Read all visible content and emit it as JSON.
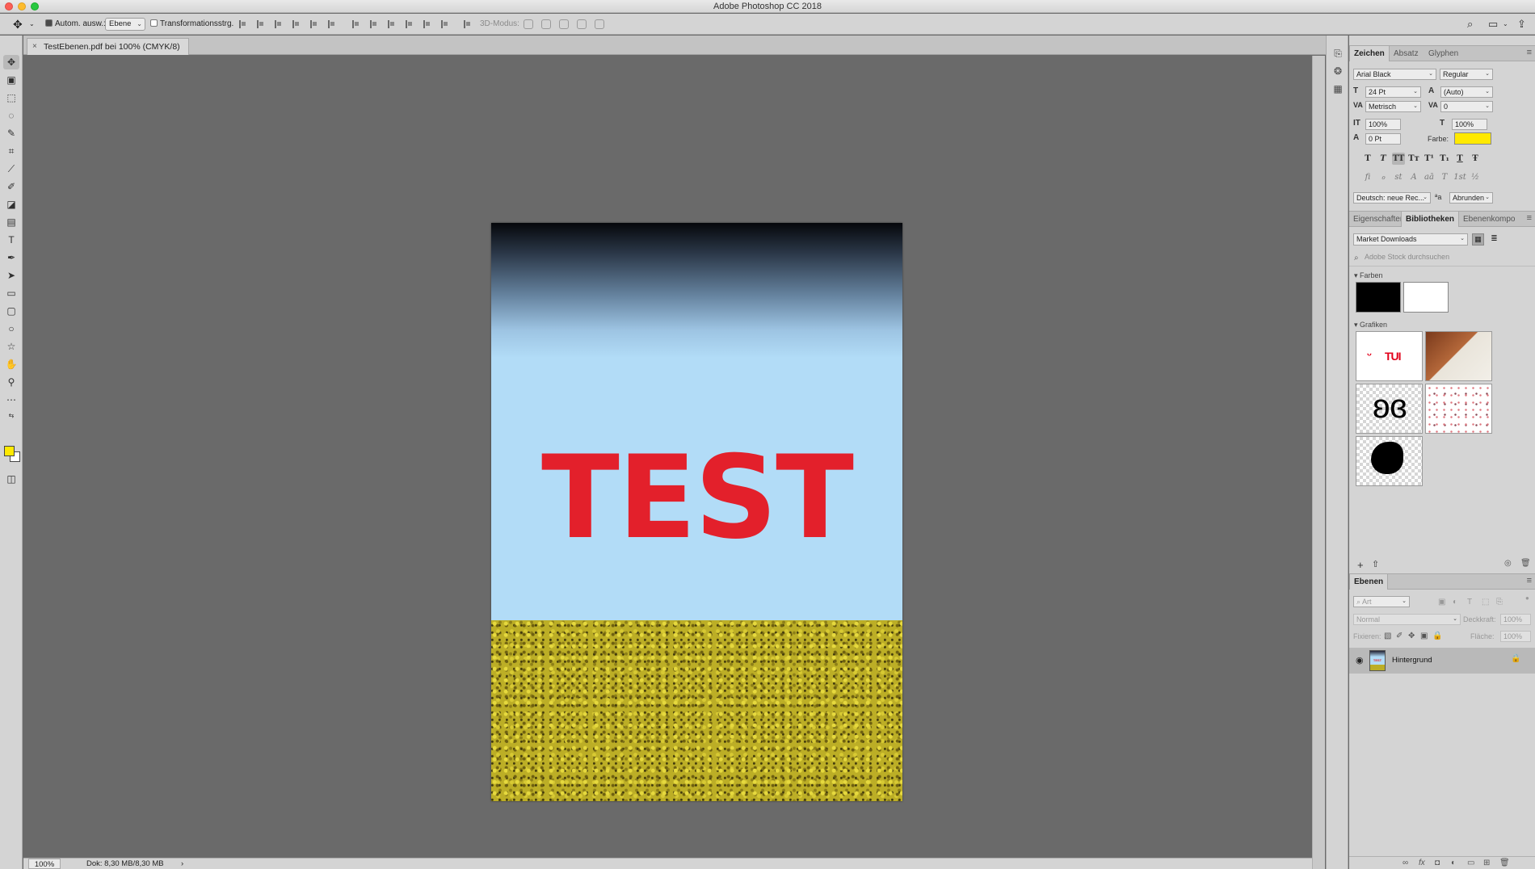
{
  "window": {
    "title": "Adobe Photoshop CC 2018"
  },
  "options_bar": {
    "auto_select_label": "Autom. ausw.:",
    "auto_select_checked": true,
    "auto_select_value": "Ebene",
    "transform_label": "Transformationsstrg.",
    "transform_checked": false,
    "mode_3d_label": "3D-Modus:"
  },
  "document_tab": {
    "title": "TestEbenen.pdf bei 100% (CMYK/8)"
  },
  "canvas": {
    "headline": "TEST",
    "headline_color": "#e3202b",
    "sky_color": "#b2dcf7",
    "grass_color": "#bcae26"
  },
  "status_bar": {
    "zoom": "100%",
    "doc_size": "Dok: 8,30 MB/8,30 MB",
    "arrow": "›"
  },
  "colors": {
    "foreground": "#ffe900",
    "background": "#ffffff"
  },
  "character_panel": {
    "tabs": [
      "Zeichen",
      "Absatz",
      "Glyphen"
    ],
    "font_family": "Arial Black",
    "font_style": "Regular",
    "font_size": "24 Pt",
    "leading": "(Auto)",
    "kerning": "Metrisch",
    "tracking": "0",
    "vertical_scale": "100%",
    "horizontal_scale": "100%",
    "baseline_shift": "0 Pt",
    "color_label": "Farbe:",
    "color_value": "#ffe900",
    "type_buttons": [
      "T",
      "T",
      "TT",
      "Tт",
      "T¹",
      "T₁",
      "T",
      "Ŧ"
    ],
    "opentype_buttons": [
      "fi",
      "ℴ",
      "st",
      "A",
      "aā",
      "T",
      "1st",
      "½"
    ],
    "language": "Deutsch: neue Rec...",
    "aa_icon": "ªa",
    "antialias": "Abrunden"
  },
  "libraries_panel": {
    "tabs": [
      "Eigenschaften",
      "Bibliotheken",
      "Ebenenkompo"
    ],
    "library_name": "Market Downloads",
    "search_placeholder": "Adobe Stock durchsuchen",
    "colors_header": "Farben",
    "color_swatches": [
      "#000000",
      "#ffffff"
    ],
    "graphics_header": "Grafiken",
    "graphics": [
      "tui-logo",
      "notebook-photo",
      "butterfly-silhouette",
      "dots-pattern",
      "chicken-silhouette"
    ],
    "tui_text": "TUI"
  },
  "layers_panel": {
    "tab": "Ebenen",
    "filter_label": "Art",
    "blend_mode": "Normal",
    "opacity_label": "Deckkraft:",
    "opacity_value": "100%",
    "lock_label": "Fixieren:",
    "fill_label": "Fläche:",
    "fill_value": "100%",
    "layer_name": "Hintergrund",
    "thumb_text": "TEST"
  }
}
